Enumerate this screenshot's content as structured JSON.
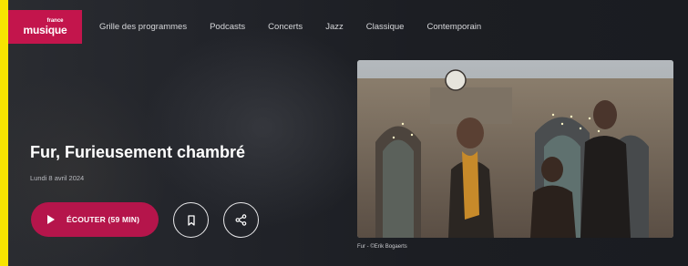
{
  "nav": {
    "logo_small": "france",
    "logo_big": "musique",
    "links": [
      "Grille des programmes",
      "Podcasts",
      "Concerts",
      "Jazz",
      "Classique",
      "Contemporain"
    ]
  },
  "episode": {
    "title": "Fur, Furieusement chambré",
    "date": "Lundi 8 avril 2024",
    "listen_label": "ÉCOUTER  (59 MIN)"
  },
  "photo": {
    "caption": "Fur - ©Erik Bogaerts"
  },
  "colors": {
    "brand": "#c3154c",
    "listen_button": "#b5154b",
    "side_stripe": "#f7e400",
    "background": "#1b1d22"
  },
  "icons": [
    "play-icon",
    "bookmark-icon",
    "share-icon"
  ]
}
